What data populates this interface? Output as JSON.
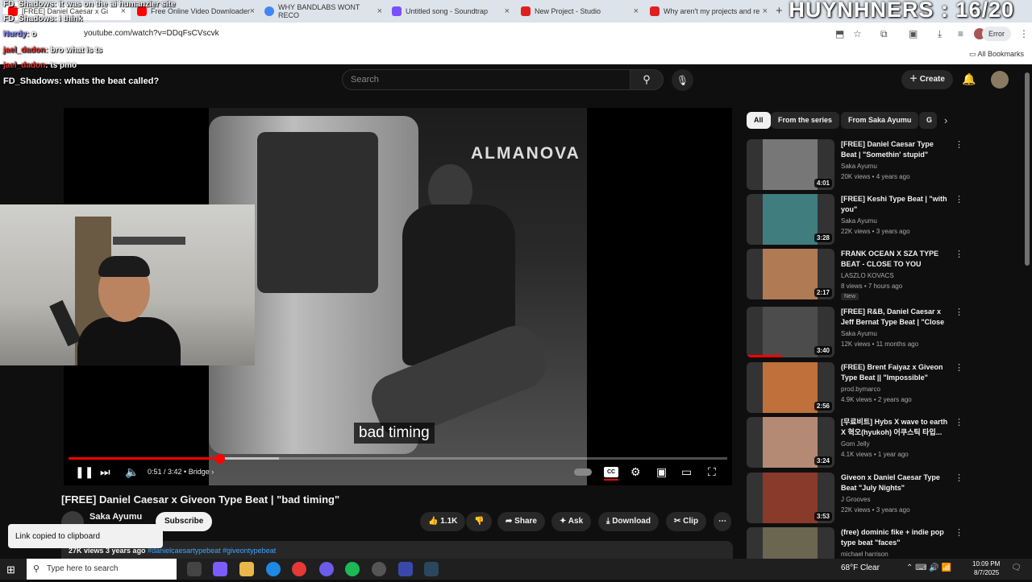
{
  "browser": {
    "tabs": [
      {
        "label": "[FREE] Daniel Caesar x Gi",
        "color": "#ff0000"
      },
      {
        "label": "Free Online Video Downloader",
        "color": "#ff0000"
      },
      {
        "label": "WHY BANDLABS WONT RECO",
        "color": "#4285f4"
      },
      {
        "label": "Untitled song - Soundtrap",
        "color": "#7b4fff"
      },
      {
        "label": "New Project - Studio",
        "color": "#e02020"
      },
      {
        "label": "Why aren't my projects and re",
        "color": "#e02020"
      }
    ],
    "overlay_counter": "HUYNHNERS : 16/20",
    "url": "youtube.com/watch?v=DDqFsCVscvk",
    "error_label": "Error",
    "all_bookmarks": "All Bookmarks"
  },
  "chat": [
    {
      "user": "FD_Shadows",
      "text": ": it was on the ai humanzier site"
    },
    {
      "user": "FD_Shadows",
      "text": ": i think"
    },
    {
      "user": "Nurdy",
      "text": ": o"
    },
    {
      "user": "jael_dadon",
      "text": ": bro what is ts"
    },
    {
      "user": "jael_dadon",
      "text": ": ts pmo"
    },
    {
      "user": "FD_Shadows",
      "text": ": whats the beat called?"
    }
  ],
  "youtube": {
    "search_placeholder": "Search",
    "create_label": "Create"
  },
  "player": {
    "sign_text": "ALMANOVA",
    "caption": "bad timing",
    "time": "0:51 / 3:42",
    "chapter": "Bridge",
    "progress": 0.23,
    "buffered": 0.32
  },
  "video": {
    "title": "[FREE] Daniel Caesar x Giveon Type Beat | \"bad timing\"",
    "channel": "Saka Ayumu",
    "subscribe": "Subscribe",
    "likes": "1.1K",
    "share": "Share",
    "ask": "Ask",
    "download": "Download",
    "clip": "Clip",
    "toast": "Link copied to clipboard",
    "views_date": "27K views  3 years ago",
    "tags": "#danielcaesartypebeat #giveontypebeat"
  },
  "chips": [
    "All",
    "From the series",
    "From Saka Ayumu",
    "G"
  ],
  "recommendations": [
    {
      "title": "[FREE] Daniel Caesar Type Beat | \"Somethin' stupid\"",
      "channel": "Saka Ayumu",
      "meta": "20K views • 4 years ago",
      "duration": "4:01",
      "thumb_color": "#777777",
      "is_new": false,
      "watched": false
    },
    {
      "title": "[FREE] Keshi Type Beat | \"with you\"",
      "channel": "Saka Ayumu",
      "meta": "22K views • 3 years ago",
      "duration": "3:28",
      "thumb_color": "#3f7d7f",
      "is_new": false,
      "watched": false
    },
    {
      "title": "FRANK OCEAN X SZA TYPE BEAT - CLOSE TO YOU",
      "channel": "LASZLO KOVACS",
      "meta": "8 views • 7 hours ago",
      "duration": "2:17",
      "thumb_color": "#b07a55",
      "is_new": true,
      "new_label": "New",
      "watched": false
    },
    {
      "title": "[FREE] R&B, Daniel Caesar x Jeff Bernat Type Beat | \"Close ...",
      "channel": "Saka Ayumu",
      "meta": "12K views • 11 months ago",
      "duration": "3:40",
      "thumb_color": "#4c4c4c",
      "is_new": false,
      "watched": true
    },
    {
      "title": "(FREE) Brent Faiyaz x Giveon Type Beat || \"Impossible\"",
      "channel": "prod.bymarco",
      "meta": "4.9K views • 2 years ago",
      "duration": "2:56",
      "thumb_color": "#c0703a",
      "is_new": false,
      "watched": false
    },
    {
      "title": "[무료비트] Hybs X wave to earth X 혁오(hyukoh) 어쿠스틱 타입...",
      "channel": "Gom Jelly",
      "meta": "4.1K views • 1 year ago",
      "duration": "3:24",
      "thumb_color": "#b58a74",
      "is_new": false,
      "watched": false
    },
    {
      "title": "Giveon x Daniel Caesar Type Beat \"July Nights\"",
      "channel": "J Grooves",
      "meta": "22K views • 3 years ago",
      "duration": "3:53",
      "thumb_color": "#8a3a2a",
      "is_new": false,
      "watched": false
    },
    {
      "title": "(free) dominic fike + indie pop type beat \"faces\"",
      "channel": "michael harrison",
      "meta": "",
      "duration": "",
      "thumb_color": "#6a6650",
      "is_new": false,
      "watched": false
    }
  ],
  "taskbar": {
    "search_placeholder": "Type here to search",
    "weather": "68°F  Clear",
    "time": "10:09 PM",
    "date": "8/7/2025"
  }
}
